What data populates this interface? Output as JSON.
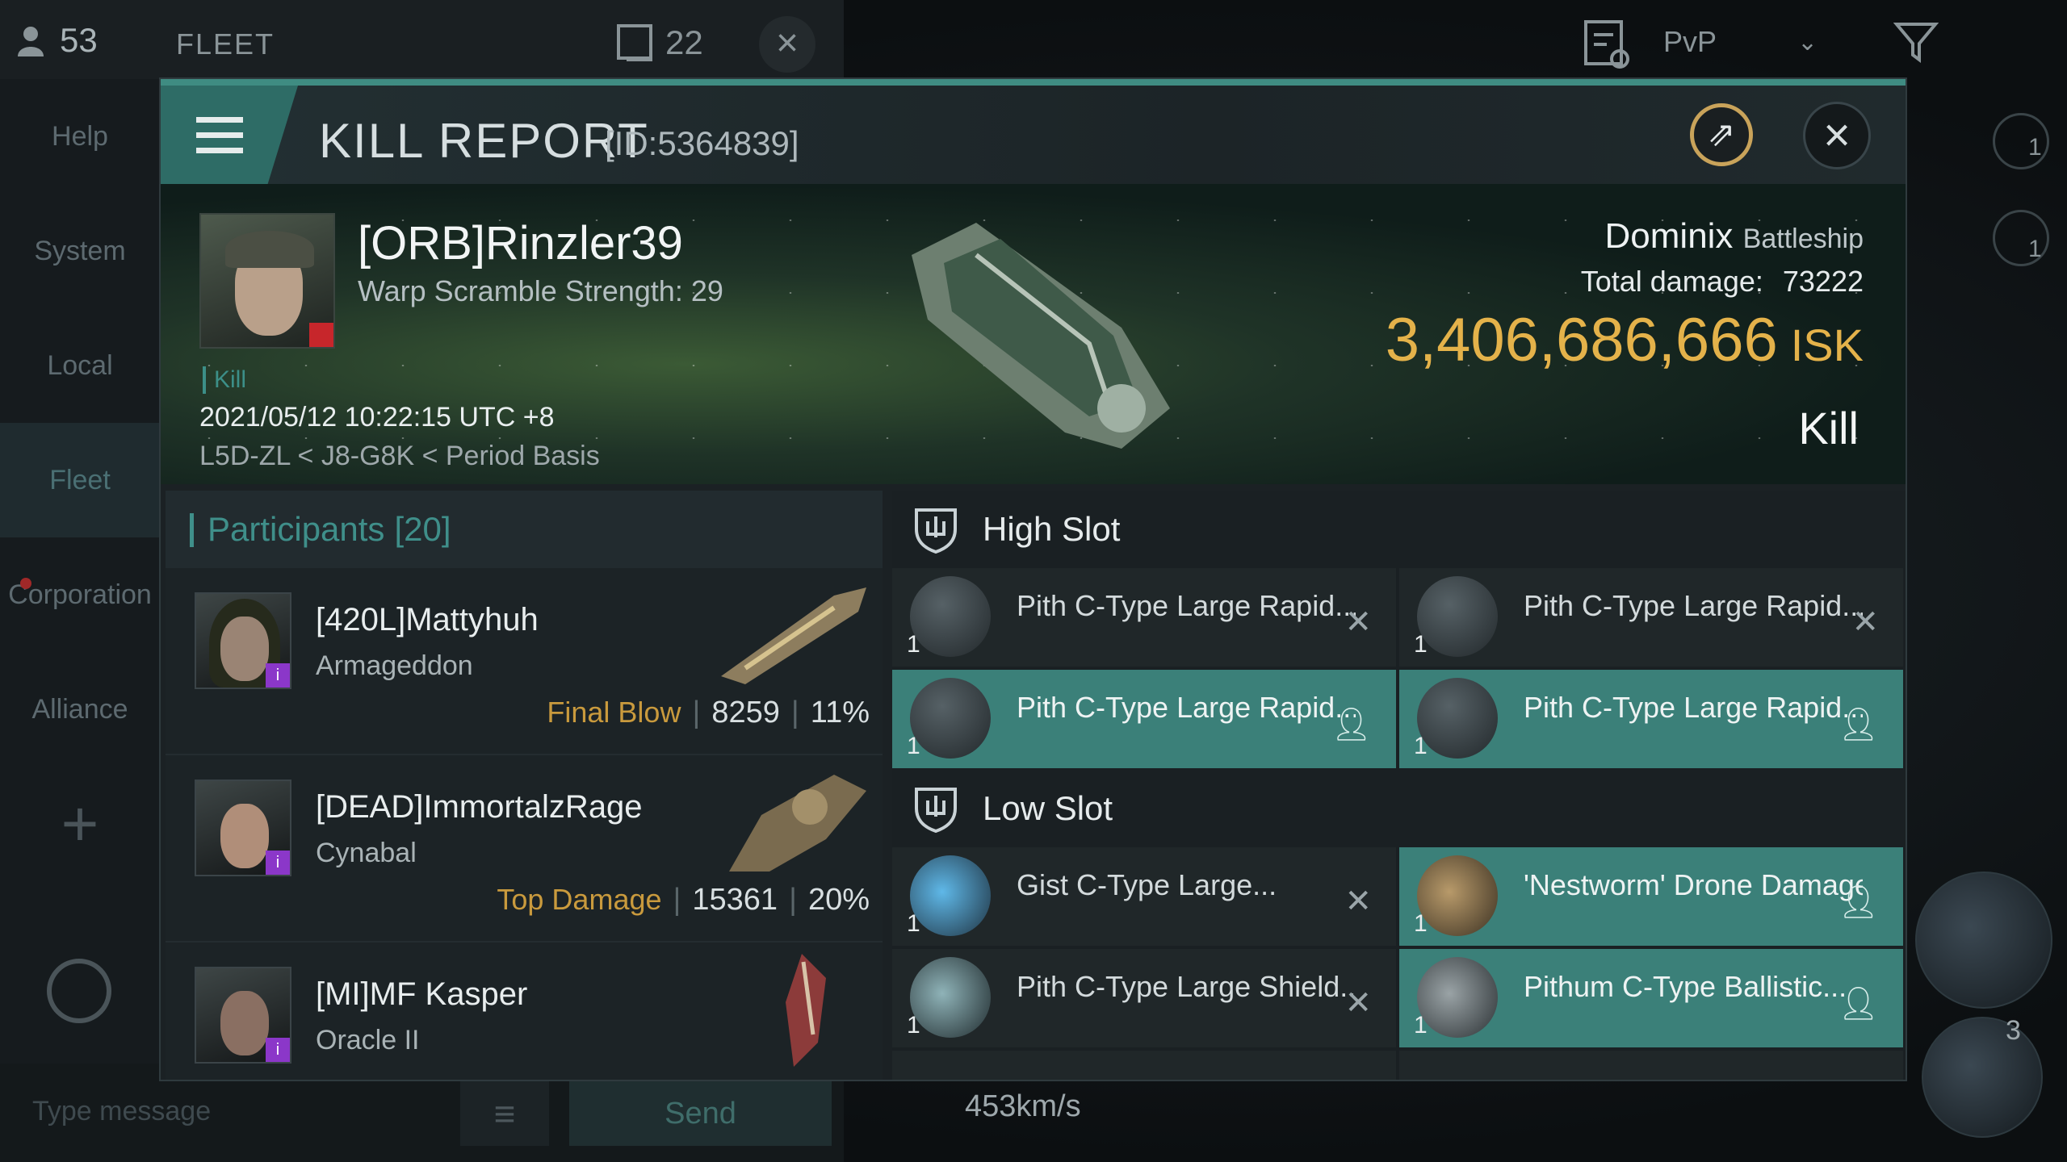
{
  "topbar": {
    "player_count": "53",
    "fleet_label": "FLEET",
    "fleet_count": "22",
    "filter_select": "PvP"
  },
  "sidebar": {
    "items": [
      {
        "label": "Help"
      },
      {
        "label": "System"
      },
      {
        "label": "Local"
      },
      {
        "label": "Fleet"
      },
      {
        "label": "Corporation"
      },
      {
        "label": "Alliance"
      }
    ]
  },
  "chat": {
    "placeholder": "Type message",
    "send_label": "Send"
  },
  "hud": {
    "speed": "453km/s",
    "drone_count": "3",
    "side_count_1": "1",
    "side_count_2": "1"
  },
  "report": {
    "title": "KILL REPORT",
    "id": "[ID:5364839]",
    "victim": {
      "name": "[ORB]Rinzler39",
      "warp_scramble": "Warp Scramble Strength: 29",
      "tag": "Kill",
      "datetime": "2021/05/12 10:22:15 UTC +8",
      "location": "L5D-ZL < J8-G8K < Period Basis"
    },
    "ship": {
      "name": "Dominix",
      "class": "Battleship",
      "total_damage_label": "Total damage:",
      "total_damage": "73222",
      "isk_value": "3,406,686,666",
      "isk_unit": "ISK",
      "result": "Kill"
    },
    "participants": {
      "label": "Participants",
      "count": "[20]",
      "rows": [
        {
          "name": "[420L]Mattyhuh",
          "ship": "Armageddon",
          "tag": "Final Blow",
          "damage": "8259",
          "percent": "11%"
        },
        {
          "name": "[DEAD]ImmortalzRage",
          "ship": "Cynabal",
          "tag": "Top Damage",
          "damage": "15361",
          "percent": "20%"
        },
        {
          "name": "[MI]MF Kasper",
          "ship": "Oracle II",
          "tag": "",
          "damage": "",
          "percent": ""
        }
      ]
    },
    "high_slot": {
      "label": "High Slot",
      "items": [
        {
          "name": "Pith C-Type Large Rapid...",
          "qty": "1",
          "state": "destroyed"
        },
        {
          "name": "Pith C-Type Large Rapid...",
          "qty": "1",
          "state": "destroyed"
        },
        {
          "name": "Pith C-Type Large Rapid...",
          "qty": "1",
          "state": "dropped"
        },
        {
          "name": "Pith C-Type Large Rapid...",
          "qty": "1",
          "state": "dropped"
        }
      ]
    },
    "low_slot": {
      "label": "Low Slot",
      "items": [
        {
          "name": "Gist C-Type Large...",
          "qty": "1",
          "state": "destroyed"
        },
        {
          "name": "'Nestworm' Drone Damage...",
          "qty": "1",
          "state": "dropped"
        },
        {
          "name": "Pith C-Type Large Shield...",
          "qty": "1",
          "state": "destroyed"
        },
        {
          "name": "Pithum C-Type Ballistic...",
          "qty": "1",
          "state": "dropped"
        }
      ]
    }
  },
  "colors": {
    "accent_teal": "#3f8c82",
    "isk_gold": "#e4b24a",
    "tag_gold": "#c99a3d",
    "fitted_slot": "#3b8079"
  }
}
